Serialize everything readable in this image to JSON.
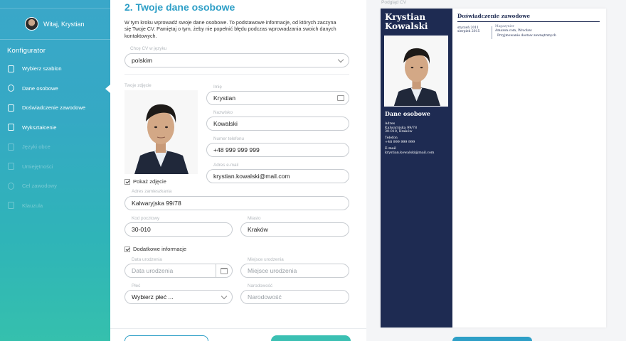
{
  "sidebar": {
    "user_greeting": "Witaj, Krystian",
    "section_title": "Konfigurator",
    "items": [
      {
        "label": "Wybierz szablon",
        "icon": "template-icon",
        "state": "done"
      },
      {
        "label": "Dane osobowe",
        "icon": "person-icon",
        "state": "active"
      },
      {
        "label": "Doświadczenie zawodowe",
        "icon": "briefcase-icon",
        "state": "done"
      },
      {
        "label": "Wykształcenie",
        "icon": "education-icon",
        "state": "done"
      },
      {
        "label": "Języki obce",
        "icon": "language-icon",
        "state": "disabled"
      },
      {
        "label": "Umiejętności",
        "icon": "skills-icon",
        "state": "disabled"
      },
      {
        "label": "Cel zawodowy",
        "icon": "target-icon",
        "state": "disabled"
      },
      {
        "label": "Klauzula",
        "icon": "clause-icon",
        "state": "disabled"
      }
    ]
  },
  "form": {
    "title": "2. Twoje dane osobowe",
    "intro": "W tym kroku wprowadź swoje dane osobowe. To podstawowe informacje, od których zaczyna się Twoje CV. Pamiętaj o tym, żeby nie popełnić błędu podczas wprowadzania swoich danych kontaktowych.",
    "language": {
      "label": "Chcę CV w języku",
      "value": "polskim"
    },
    "photo_label": "Twoje zdjęcie",
    "show_photo_label": "Pokaż zdjęcie",
    "first_name": {
      "label": "Imię",
      "value": "Krystian"
    },
    "last_name": {
      "label": "Nazwisko",
      "value": "Kowalski"
    },
    "phone": {
      "label": "Numer telefonu",
      "value": "+48 999 999 999"
    },
    "email": {
      "label": "Adres e-mail",
      "value": "krystian.kowalski@mail.com"
    },
    "address": {
      "label": "Adres zamieszkania",
      "value": "Kalwaryjska 99/78"
    },
    "postal_code": {
      "label": "Kod pocztowy",
      "value": "30-010"
    },
    "city": {
      "label": "Miasto",
      "value": "Kraków"
    },
    "additional_info_label": "Dodatkowe informacje",
    "birth_date": {
      "label": "Data urodzenia",
      "placeholder": "Data urodzenia"
    },
    "birth_place": {
      "label": "Miejsce urodzenia",
      "placeholder": "Miejsce urodzenia"
    },
    "gender": {
      "label": "Płeć",
      "value": "Wybierz płeć ..."
    },
    "nationality": {
      "label": "Narodowość",
      "placeholder": "Narodowość"
    }
  },
  "preview": {
    "label": "Podgląd CV",
    "name_line1": "Krystian",
    "name_line2": "Kowalski",
    "personal_heading": "Dane osobowe",
    "address_label": "Adres",
    "address_line1": "Kalwaryjska 99/78",
    "address_line2": "30-010, Kraków",
    "phone_label": "Telefon",
    "phone_value": "+48 999 999 999",
    "email_label": "E-mail",
    "email_value": "krystian.kowalski@mail.com",
    "experience_heading": "Doświadczenie zawodowe",
    "exp_date_from": "styczeń 2011",
    "exp_date_to": "sierpień 2015",
    "exp_position": "Magazynier",
    "exp_company": "Amazon.com, Wrocław",
    "exp_task": "Przyjmowanie dostaw zewnętrznych"
  },
  "colors": {
    "accent": "#2e9fc7",
    "cv_navy": "#1e2b52",
    "teal": "#3bc0b3"
  }
}
